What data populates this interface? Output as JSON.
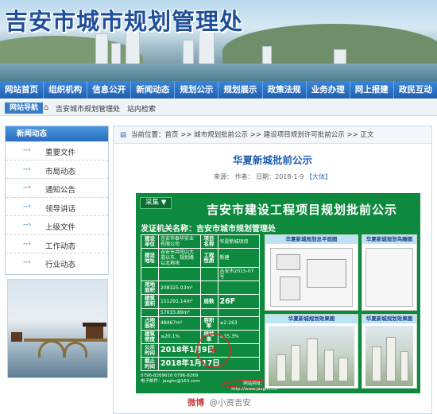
{
  "site": {
    "title": "吉安市城市规划管理处"
  },
  "nav": [
    "网站首页",
    "组织机构",
    "信息公开",
    "新闻动态",
    "规划公示",
    "规划展示",
    "政策法规",
    "业务办理",
    "网上报建",
    "政民互动"
  ],
  "breadcrumb_bar": {
    "tag": "网站导航",
    "links": "吉安城市规划管理处　站内检索"
  },
  "sidebar": {
    "heading": "新闻动态",
    "items": [
      "重要文件",
      "市局动态",
      "通知公告",
      "领导讲话",
      "上级文件",
      "工作动态",
      "行业动态"
    ]
  },
  "main": {
    "location": "当前位置：首页 >> 城市规划批前公示 >> 建设项目规划许可批前公示 >> 正文",
    "article_title": "华夏新城批前公示",
    "meta": {
      "prefix": "来源：",
      "author": "作者：",
      "date": "日期：2018-1-9",
      "size": "【大体】"
    }
  },
  "notice": {
    "collect_button": "采集 ▼",
    "caption": "吉安市建设工程项目规划批前公示",
    "issuer": "发证机关名称：吉安市城市规划管理处",
    "rows": [
      {
        "k": "建设单位",
        "v": "吉安市泰华实业有限公司",
        "k2": "项目名称",
        "v2": "华夏新城项目"
      },
      {
        "k": "建设地址",
        "v": "吉安市井冈山大道以东、规划路以北地块",
        "k2": "工程性质",
        "v2": "新建"
      },
      {
        "k": "",
        "v": "",
        "k2": "",
        "v2": "吉安市2015-07号"
      },
      {
        "k": "用地面积",
        "v": "208325.03m²",
        "k2": "",
        "v2": ""
      },
      {
        "k": "建筑面积",
        "v": "151291.14m²",
        "k2": "层数",
        "v2": "26F"
      },
      {
        "k": "",
        "v": "57033.89m²",
        "k2": "",
        "v2": ""
      },
      {
        "k": "占地面积",
        "v": "48467m²",
        "k2": "容积率",
        "v2": "≤2.263"
      },
      {
        "k": "建筑密度",
        "v": "≤20.1%",
        "k2": "绿地率",
        "v2": "≥35.3%"
      },
      {
        "k": "公示时间",
        "v": "2018年1月9日",
        "k2": "",
        "v2": ""
      },
      {
        "k": "截止时间",
        "v": "2018年1月17日",
        "k2": "",
        "v2": ""
      }
    ],
    "contact_phone": "0796-8269616 0796-8269",
    "contact_email": "电子邮件：jasghc@163.com",
    "website": "网站网址：http://www.jasghc.cn",
    "panel_titles": [
      "华夏新城规划总平面图",
      "华夏新城规划鸟瞰图",
      "华夏新城规划效果图",
      "华夏新城规划效果图"
    ]
  },
  "watermark": {
    "prefix": "微博",
    "handle": "@小资吉安"
  }
}
